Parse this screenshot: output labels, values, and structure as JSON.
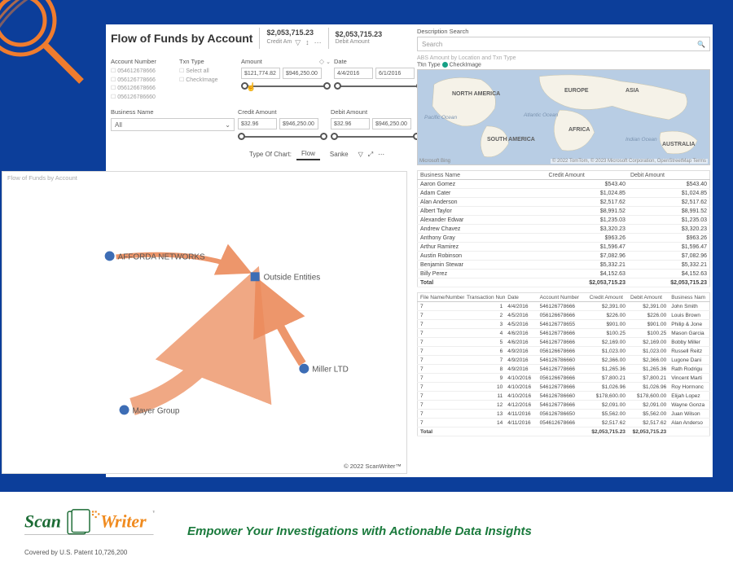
{
  "title": "Flow of Funds by Account",
  "kpi": {
    "value": "$2,053,715.23",
    "credit_label": "Credit Am",
    "debit_label": "Debit Amount"
  },
  "filters": {
    "account_label": "Account Number",
    "accounts": [
      "054612678666",
      "056126778666",
      "056126678666",
      "056126786660"
    ],
    "txn_type_label": "Txn Type",
    "txn_options": [
      "Select all",
      "CheckImage"
    ],
    "amount_label": "Amount",
    "amount_min": "$121,774.82",
    "amount_max": "$946,250.00",
    "date_label": "Date",
    "date_from": "4/4/2016",
    "date_to": "6/1/2016",
    "business_label": "Business Name",
    "business_value": "All",
    "credit_label": "Credit Amount",
    "credit_min": "$32.96",
    "credit_max": "$946,250.00",
    "debit_label": "Debit Amount",
    "debit_min": "$32.96",
    "debit_max": "$946,250.00"
  },
  "chart_type": {
    "label": "Type Of Chart:",
    "opt1": "Flow",
    "opt2": "Sanke"
  },
  "flow": {
    "caption": "Flow of Funds by Account",
    "n1": "AFFORDA NETWORKS",
    "n2": "Outside Entities",
    "n3": "Miller LTD",
    "n4": "Mayer Group",
    "copyright": "© 2022 ScanWriter™"
  },
  "search": {
    "label": "Description Search",
    "placeholder": "Search"
  },
  "map_heading": "ABS Amount by Location and Txn Type",
  "map_legend": {
    "label": "Txn Type",
    "item": "CheckImage"
  },
  "map_labels": {
    "na": "NORTH AMERICA",
    "eu": "EUROPE",
    "as": "ASIA",
    "sa": "SOUTH AMERICA",
    "af": "AFRICA",
    "au": "AUSTRALIA",
    "pac": "Pacific\nOcean",
    "atl": "Atlantic\nOcean",
    "ind": "Indian\nOcean",
    "attrib": "© 2022 TomTom, © 2023 Microsoft Corporation,   OpenStreetMap   Terms",
    "bing": "Microsoft Bing"
  },
  "summary_table": {
    "headers": [
      "Business Name",
      "Credit Amount",
      "Debit Amount"
    ],
    "rows": [
      [
        "Aaron Gomez",
        "$543.40",
        "$543.40"
      ],
      [
        "Adam Cater",
        "$1,024.85",
        "$1,024.85"
      ],
      [
        "Alan Anderson",
        "$2,517.62",
        "$2,517.62"
      ],
      [
        "Albert Taylor",
        "$8,991.52",
        "$8,991.52"
      ],
      [
        "Alexander Edwar",
        "$1,235.03",
        "$1,235.03"
      ],
      [
        "Andrew Chavez",
        "$3,320.23",
        "$3,320.23"
      ],
      [
        "Anthony Gray",
        "$963.26",
        "$963.26"
      ],
      [
        "Arthur Ramirez",
        "$1,596.47",
        "$1,596.47"
      ],
      [
        "Austin Robinson",
        "$7,082.96",
        "$7,082.96"
      ],
      [
        "Benjamin Stewar",
        "$5,332.21",
        "$5,332.21"
      ],
      [
        "Billy Perez",
        "$4,152.63",
        "$4,152.63"
      ]
    ],
    "total_label": "Total",
    "total_credit": "$2,053,715.23",
    "total_debit": "$2,053,715.23"
  },
  "detail_table": {
    "headers": [
      "File Name/Number",
      "Transaction Number",
      "Date",
      "Account Number",
      "Credit Amount",
      "Debit Amount",
      "Business Nam"
    ],
    "rows": [
      [
        "7",
        "1",
        "4/4/2016",
        "546126778666",
        "$2,391.00",
        "$2,391.00",
        "John Smith"
      ],
      [
        "7",
        "2",
        "4/5/2016",
        "056126678666",
        "$226.00",
        "$226.00",
        "Louis Brown"
      ],
      [
        "7",
        "3",
        "4/5/2016",
        "546126778655",
        "$901.00",
        "$901.00",
        "Philip & Jone"
      ],
      [
        "7",
        "4",
        "4/6/2016",
        "546126778666",
        "$100.25",
        "$100.25",
        "Mason Garcia"
      ],
      [
        "7",
        "5",
        "4/6/2016",
        "546126778666",
        "$2,169.00",
        "$2,169.00",
        "Bobby Miller"
      ],
      [
        "7",
        "6",
        "4/9/2016",
        "056126678666",
        "$1,023.00",
        "$1,023.00",
        "Russell Reitz"
      ],
      [
        "7",
        "7",
        "4/9/2016",
        "546126786660",
        "$2,366.00",
        "$2,366.00",
        "Lugone Dani"
      ],
      [
        "7",
        "8",
        "4/9/2016",
        "546126778666",
        "$1,265.36",
        "$1,265.36",
        "Rath Rodrigu"
      ],
      [
        "7",
        "9",
        "4/10/2016",
        "056126678666",
        "$7,800.21",
        "$7,800.21",
        "Vincent Marti"
      ],
      [
        "7",
        "10",
        "4/10/2016",
        "546126778666",
        "$1,026.96",
        "$1,026.96",
        "Roy Hormonc"
      ],
      [
        "7",
        "11",
        "4/10/2016",
        "546126786660",
        "$178,600.00",
        "$178,600.00",
        "Elijah Lopez"
      ],
      [
        "7",
        "12",
        "4/12/2016",
        "546126778666",
        "$2,091.00",
        "$2,091.00",
        "Wayne Gonza"
      ],
      [
        "7",
        "13",
        "4/11/2016",
        "056126786650",
        "$5,562.00",
        "$5,562.00",
        "Juan Wilson"
      ],
      [
        "7",
        "14",
        "4/11/2016",
        "054612678666",
        "$2,517.62",
        "$2,517.62",
        "Alan Anderso"
      ]
    ],
    "total_label": "Total",
    "total_credit": "$2,053,715.23",
    "total_debit": "$2,053,715.23"
  },
  "footer": {
    "brand1": "Scan",
    "brand2": "Writer",
    "patent": "Covered by U.S. Patent 10,726,200",
    "tagline": "Empower Your Investigations with Actionable Data Insights"
  }
}
